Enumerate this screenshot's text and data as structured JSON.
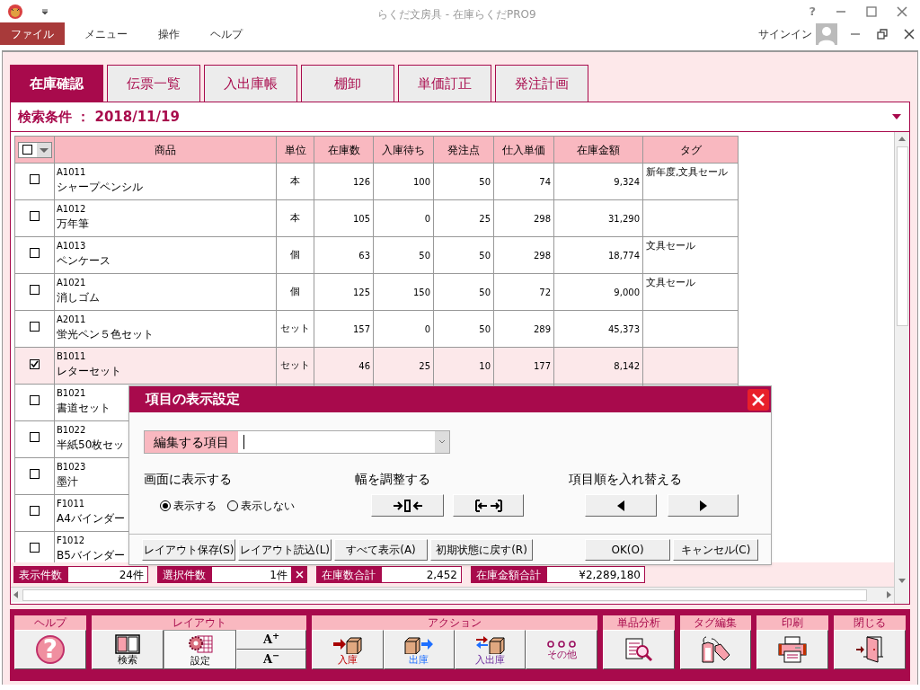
{
  "window": {
    "title": "らくだ文房具 - 在庫らくだPRO9",
    "help": "?"
  },
  "menu": [
    {
      "label": "ファイル",
      "selected": true
    },
    {
      "label": "メニュー",
      "selected": false
    },
    {
      "label": "操作",
      "selected": false
    },
    {
      "label": "ヘルプ",
      "selected": false
    }
  ],
  "account": {
    "label": "サインイン"
  },
  "tabs": [
    {
      "label": "在庫確認",
      "selected": true
    },
    {
      "label": "伝票一覧",
      "selected": false
    },
    {
      "label": "入出庫帳",
      "selected": false
    },
    {
      "label": "棚卸",
      "selected": false
    },
    {
      "label": "単価訂正",
      "selected": false
    },
    {
      "label": "発注計画",
      "selected": false
    }
  ],
  "search_condition": "検索条件 ： 2018/11/19",
  "table": {
    "all_checked": false,
    "columns": [
      "商品",
      "単位",
      "在庫数",
      "入庫待ち",
      "発注点",
      "仕入単価",
      "在庫金額",
      "タグ"
    ],
    "rows": [
      {
        "checked": false,
        "code": "A1011",
        "name": "シャープペンシル",
        "unit": "本",
        "stock": "126",
        "incoming": "100",
        "reorder_point": "50",
        "unit_cost": "74",
        "stock_value": "9,324",
        "tags": "新年度,文具セール"
      },
      {
        "checked": false,
        "code": "A1012",
        "name": "万年筆",
        "unit": "本",
        "stock": "105",
        "incoming": "0",
        "reorder_point": "25",
        "unit_cost": "298",
        "stock_value": "31,290"
      },
      {
        "checked": false,
        "code": "A1013",
        "name": "ペンケース",
        "unit": "個",
        "stock": "63",
        "incoming": "50",
        "reorder_point": "50",
        "unit_cost": "298",
        "stock_value": "18,774",
        "tags": "文具セール"
      },
      {
        "checked": false,
        "code": "A1021",
        "name": "消しゴム",
        "unit": "個",
        "stock": "125",
        "incoming": "150",
        "reorder_point": "50",
        "unit_cost": "72",
        "stock_value": "9,000",
        "tags": "文具セール"
      },
      {
        "checked": false,
        "code": "A2011",
        "name": "蛍光ペン５色セット",
        "unit": "セット",
        "stock": "157",
        "incoming": "0",
        "reorder_point": "50",
        "unit_cost": "289",
        "stock_value": "45,373"
      },
      {
        "checked": true,
        "code": "B1011",
        "name": "レターセット",
        "unit": "セット",
        "stock": "46",
        "incoming": "25",
        "reorder_point": "10",
        "unit_cost": "177",
        "stock_value": "8,142"
      },
      {
        "checked": false,
        "code": "B1021",
        "name": "書道セット"
      },
      {
        "checked": false,
        "code": "B1022",
        "name": "半紙50枚セッ"
      },
      {
        "checked": false,
        "code": "B1023",
        "name": "墨汁"
      },
      {
        "checked": false,
        "code": "F1011",
        "name": "A4バインダー"
      },
      {
        "checked": false,
        "code": "F1012",
        "name": "B5バインダー"
      }
    ]
  },
  "summary": [
    {
      "label": "表示件数",
      "value": "24件"
    },
    {
      "label": "選択件数",
      "value": "1件"
    },
    {
      "label": "在庫数合計",
      "value": "2,452"
    },
    {
      "label": "在庫金額合計",
      "value": "¥2,289,180"
    }
  ],
  "toolbar": [
    {
      "title": "ヘルプ",
      "buttons": [
        {
          "kind": "help",
          "label": "?",
          "pressed": false
        }
      ]
    },
    {
      "title": "レイアウト",
      "buttons": [
        {
          "kind": "search",
          "label": "検索",
          "pressed": false
        },
        {
          "kind": "settings",
          "label": "設定",
          "pressed": true
        },
        {
          "kind": "font_size",
          "items": [
            "A$^{+}$",
            "A$^{−}$"
          ],
          "pressed": false
        }
      ]
    },
    {
      "title": "アクション",
      "buttons": [
        {
          "kind": "stock_in",
          "label": "入庫",
          "pressed": false
        },
        {
          "kind": "stock_out",
          "label": "出庫",
          "pressed": false
        },
        {
          "kind": "stock_inout",
          "label": "入出庫",
          "pressed": false
        },
        {
          "kind": "more",
          "label": "その他",
          "pressed": false
        }
      ]
    },
    {
      "title": "単品分析",
      "buttons": [
        {
          "kind": "analysis",
          "pressed": false
        }
      ]
    },
    {
      "title": "タグ編集",
      "buttons": [
        {
          "kind": "tag",
          "pressed": false
        }
      ]
    },
    {
      "title": "印刷",
      "buttons": [
        {
          "kind": "print",
          "pressed": false
        }
      ]
    },
    {
      "title": "閉じる",
      "buttons": [
        {
          "kind": "exit",
          "pressed": false
        }
      ]
    }
  ],
  "dialog": {
    "title": "項目の表示設定",
    "field_label": "編集する項目",
    "visibility": {
      "label": "画面に表示する",
      "options": [
        {
          "label": "表示する",
          "selected": true
        },
        {
          "label": "表示しない",
          "selected": false
        }
      ]
    },
    "width": {
      "label": "幅を調整する"
    },
    "order": {
      "label": "項目順を入れ替える"
    },
    "footer_left": [
      "レイアウト保存(S)",
      "レイアウト読込(L)",
      "すべて表示(A)",
      "初期状態に戻す(R)"
    ],
    "footer_right": [
      "OK(O)",
      "キャンセル(C)"
    ]
  }
}
